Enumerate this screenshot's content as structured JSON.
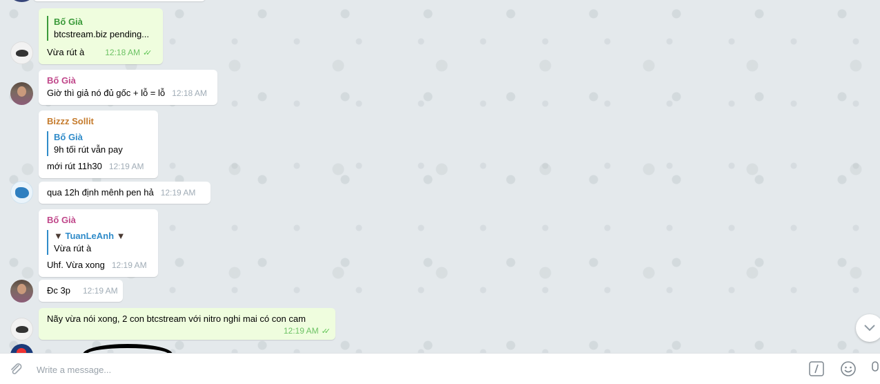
{
  "messages": [
    {
      "id": "m1",
      "sender": "Bố Già",
      "reply": {
        "name": "Bố Già",
        "text": "btcstream.biz pending..."
      },
      "text": "Vừa rút à",
      "time": "12:18 AM",
      "outgoing": true
    },
    {
      "id": "m2",
      "sender": "Bố Già",
      "text": "Giờ thì giả nó đủ gốc + lỗ = lỗ",
      "time": "12:18 AM"
    },
    {
      "id": "m3",
      "sender": "Bizzz Sollit",
      "reply": {
        "name": "Bố Già",
        "text": "9h tối rút vẫn pay"
      },
      "text": "mới rút 11h30",
      "time": "12:19 AM"
    },
    {
      "id": "m4",
      "text": "qua 12h định mênh pen hả",
      "time": "12:19 AM"
    },
    {
      "id": "m5",
      "sender": "Bố Già",
      "reply": {
        "name": "TuanLeAnh",
        "text": "Vừa rút à"
      },
      "text": "Uhf. Vừa xong",
      "time": "12:19 AM"
    },
    {
      "id": "m6",
      "text": "Đc 3p",
      "time": "12:19 AM"
    },
    {
      "id": "m7",
      "text": "Nãy vừa nói xong, 2 con btcstream với nitro nghi mai có con cam",
      "time": "12:19 AM",
      "outgoing": true
    }
  ],
  "composer": {
    "placeholder": "Write a message...",
    "icons": [
      "paperclip-icon",
      "slash-commands-icon",
      "emoji-icon",
      "microphone-icon"
    ]
  },
  "icons": {
    "scroll_down": "chevron-down-icon",
    "read_receipt": "double-check-icon"
  }
}
